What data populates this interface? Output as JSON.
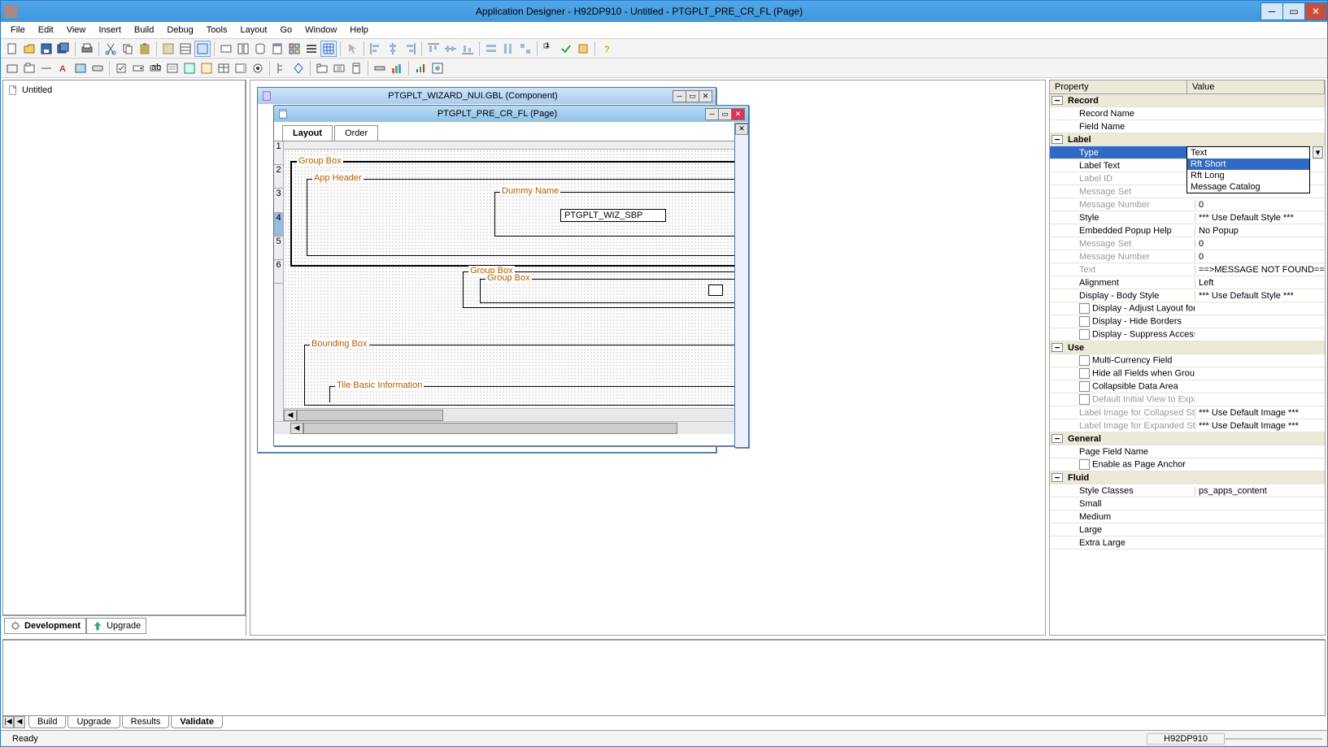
{
  "app": {
    "title": "Application Designer - H92DP910 - Untitled - PTGPLT_PRE_CR_FL (Page)"
  },
  "menu": [
    "File",
    "Edit",
    "View",
    "Insert",
    "Build",
    "Debug",
    "Tools",
    "Layout",
    "Go",
    "Window",
    "Help"
  ],
  "tree": {
    "root": "Untitled"
  },
  "left_tabs": {
    "dev": "Development",
    "upg": "Upgrade"
  },
  "mdi_component": {
    "title": "PTGPLT_WIZARD_NUI.GBL (Component)"
  },
  "mdi_page": {
    "title": "PTGPLT_PRE_CR_FL (Page)",
    "tabs": {
      "layout": "Layout",
      "order": "Order"
    },
    "labels": {
      "groupbox1": "Group Box",
      "appheader": "App Header",
      "dummy": "Dummy Name",
      "field1": "PTGPLT_WIZ_SBP",
      "groupbox2": "Group Box",
      "groupbox3": "Group Box",
      "bounding": "Bounding Box",
      "tilebasic": "Tile Basic Information"
    }
  },
  "propgrid": {
    "headers": {
      "property": "Property",
      "value": "Value"
    },
    "groups": {
      "record": {
        "label": "Record",
        "items": [
          {
            "name": "Record Name",
            "val": ""
          },
          {
            "name": "Field Name",
            "val": ""
          }
        ]
      },
      "label": {
        "label": "Label",
        "items": [
          {
            "name": "Type",
            "val": "Text",
            "selected": true,
            "dropdown": true
          },
          {
            "name": "Label Text",
            "val": ""
          },
          {
            "name": "Label ID",
            "val": "",
            "disabled": true
          },
          {
            "name": "Message Set",
            "val": "",
            "disabled": true
          },
          {
            "name": "Message Number",
            "val": "0",
            "disabled": true
          },
          {
            "name": "Style",
            "val": "*** Use Default Style ***"
          },
          {
            "name": "Embedded Popup Help",
            "val": "No Popup"
          },
          {
            "name": "Message Set",
            "val": "0",
            "disabled": true
          },
          {
            "name": "Message Number",
            "val": "0",
            "disabled": true
          },
          {
            "name": "Text",
            "val": "==>MESSAGE NOT FOUND==",
            "disabled": true
          },
          {
            "name": "Alignment",
            "val": "Left"
          },
          {
            "name": "Display - Body Style",
            "val": "*** Use Default Style ***"
          },
          {
            "name": "Display - Adjust Layout for Hi...",
            "val": "",
            "checkbox": true
          },
          {
            "name": "Display - Hide Borders",
            "val": "",
            "checkbox": true
          },
          {
            "name": "Display - Suppress Accessibil...",
            "val": "",
            "checkbox": true
          }
        ]
      },
      "use": {
        "label": "Use",
        "items": [
          {
            "name": "Multi-Currency Field",
            "val": "",
            "checkbox": true
          },
          {
            "name": "Hide all Fields when Group B...",
            "val": "",
            "checkbox": true
          },
          {
            "name": "Collapsible Data Area",
            "val": "",
            "checkbox": true
          },
          {
            "name": "Default Initial View to Expan...",
            "val": "",
            "checkbox": true,
            "disabled": true
          },
          {
            "name": "Label Image for Collapsed State",
            "val": "*** Use Default Image ***",
            "disabled": true
          },
          {
            "name": "Label Image for Expanded State",
            "val": "*** Use Default Image ***",
            "disabled": true
          }
        ]
      },
      "general": {
        "label": "General",
        "items": [
          {
            "name": "Page Field Name",
            "val": ""
          },
          {
            "name": "Enable as Page Anchor",
            "val": "",
            "checkbox": true
          }
        ]
      },
      "fluid": {
        "label": "Fluid",
        "items": [
          {
            "name": "Style Classes",
            "val": "ps_apps_content"
          },
          {
            "name": "Small",
            "val": ""
          },
          {
            "name": "Medium",
            "val": ""
          },
          {
            "name": "Large",
            "val": ""
          },
          {
            "name": "Extra Large",
            "val": ""
          }
        ]
      }
    },
    "dropdown_options": [
      "Text",
      "Rft Short",
      "Rft Long",
      "Message Catalog"
    ],
    "dropdown_hover_index": 1
  },
  "bottom_tabs": {
    "build": "Build",
    "upgrade": "Upgrade",
    "results": "Results",
    "validate": "Validate"
  },
  "status": {
    "ready": "Ready",
    "db": "H92DP910"
  }
}
